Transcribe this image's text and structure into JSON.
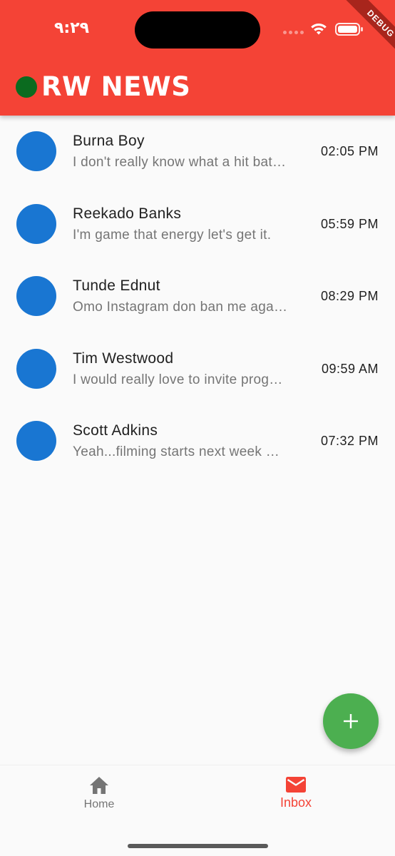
{
  "status_bar": {
    "time": "٩:٢٩",
    "debug_label": "DEBUG"
  },
  "header": {
    "title": "RW NEWS",
    "color": "#f44336",
    "dot_color": "#0b6b1f"
  },
  "messages": [
    {
      "name": "Burna Boy",
      "preview": "I don't really know what a hit bat…",
      "time": "02:05 PM"
    },
    {
      "name": "Reekado Banks",
      "preview": "I'm game that energy let's get it.",
      "time": "05:59 PM"
    },
    {
      "name": "Tunde Ednut",
      "preview": "Omo Instagram don ban me aga…",
      "time": "08:29 PM"
    },
    {
      "name": "Tim Westwood",
      "preview": "I would really love to invite prog…",
      "time": "09:59 AM"
    },
    {
      "name": "Scott Adkins",
      "preview": "Yeah...filming starts next week …",
      "time": "07:32 PM"
    }
  ],
  "avatar_color": "#1976d2",
  "fab": {
    "icon": "plus-icon",
    "color": "#4caf50"
  },
  "bottom_nav": {
    "items": [
      {
        "label": "Home",
        "icon": "home-icon",
        "selected": false
      },
      {
        "label": "Inbox",
        "icon": "mail-icon",
        "selected": true
      }
    ],
    "selected_color": "#f44336"
  }
}
